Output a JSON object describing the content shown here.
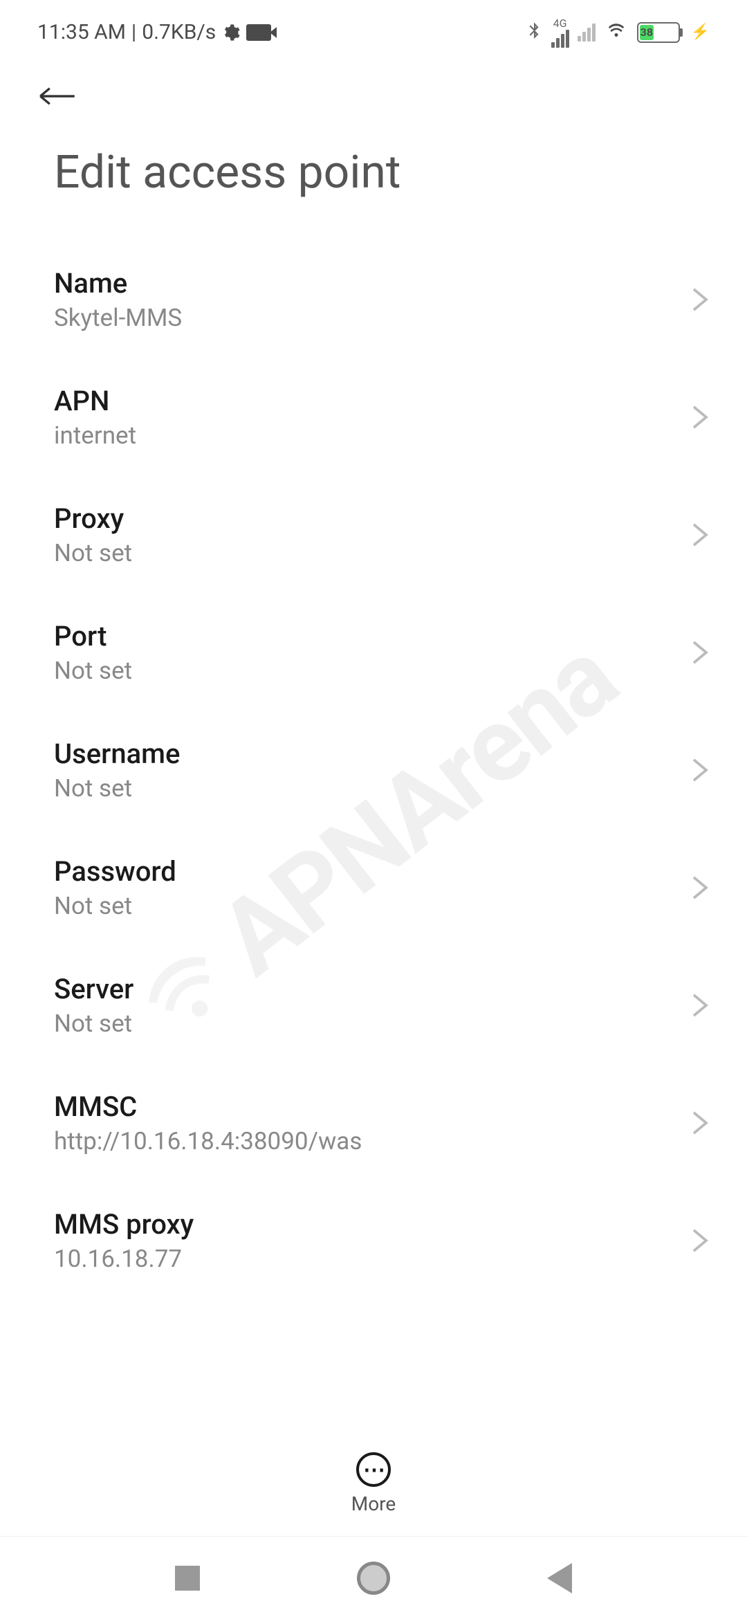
{
  "statusBar": {
    "time": "11:35 AM",
    "dataRate": "0.7KB/s",
    "networkType": "4G",
    "batteryPercent": "38"
  },
  "header": {
    "title": "Edit access point"
  },
  "settings": [
    {
      "label": "Name",
      "value": "Skytel-MMS"
    },
    {
      "label": "APN",
      "value": "internet"
    },
    {
      "label": "Proxy",
      "value": "Not set"
    },
    {
      "label": "Port",
      "value": "Not set"
    },
    {
      "label": "Username",
      "value": "Not set"
    },
    {
      "label": "Password",
      "value": "Not set"
    },
    {
      "label": "Server",
      "value": "Not set"
    },
    {
      "label": "MMSC",
      "value": "http://10.16.18.4:38090/was"
    },
    {
      "label": "MMS proxy",
      "value": "10.16.18.77"
    }
  ],
  "bottomBar": {
    "moreLabel": "More"
  },
  "watermark": "APNArena"
}
